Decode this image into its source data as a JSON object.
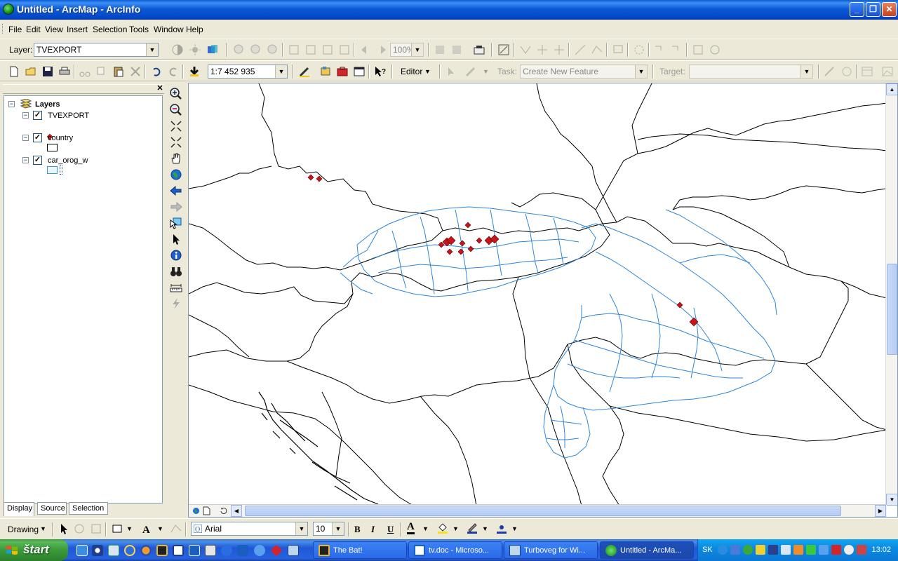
{
  "window": {
    "title": "Untitled - ArcMap - ArcInfo"
  },
  "menu": [
    "File",
    "Edit",
    "View",
    "Insert",
    "Selection",
    "Tools",
    "Window",
    "Help"
  ],
  "layer_toolbar": {
    "label": "Layer:",
    "value": "TVEXPORT",
    "zoom": "100%"
  },
  "standard_toolbar": {
    "scale": "1:7 452 935"
  },
  "editor_toolbar": {
    "editor_label": "Editor",
    "task_label": "Task:",
    "task_value": "Create New Feature",
    "target_label": "Target:",
    "target_value": ""
  },
  "toc": {
    "root": "Layers",
    "layers": [
      {
        "name": "TVEXPORT",
        "checked": true,
        "symbol": "point"
      },
      {
        "name": "country",
        "checked": true,
        "symbol": "polygon"
      },
      {
        "name": "car_orog_w",
        "checked": true,
        "symbol": "polygon-blue"
      }
    ],
    "tabs": [
      "Display",
      "Source",
      "Selection"
    ]
  },
  "drawing_toolbar": {
    "drawing_label": "Drawing",
    "font": "Arial",
    "size": "10",
    "bold": "B",
    "italic": "I",
    "underline": "U",
    "font_color": "A"
  },
  "taskbar": {
    "start": "štart",
    "tasks": [
      {
        "label": "The Bat!",
        "active": false
      },
      {
        "label": "tv.doc - Microso...",
        "active": false
      },
      {
        "label": "Turboveg for Wi...",
        "active": false
      },
      {
        "label": "Untitled - ArcMa...",
        "active": true
      }
    ],
    "lang": "SK",
    "clock": "13:02"
  }
}
